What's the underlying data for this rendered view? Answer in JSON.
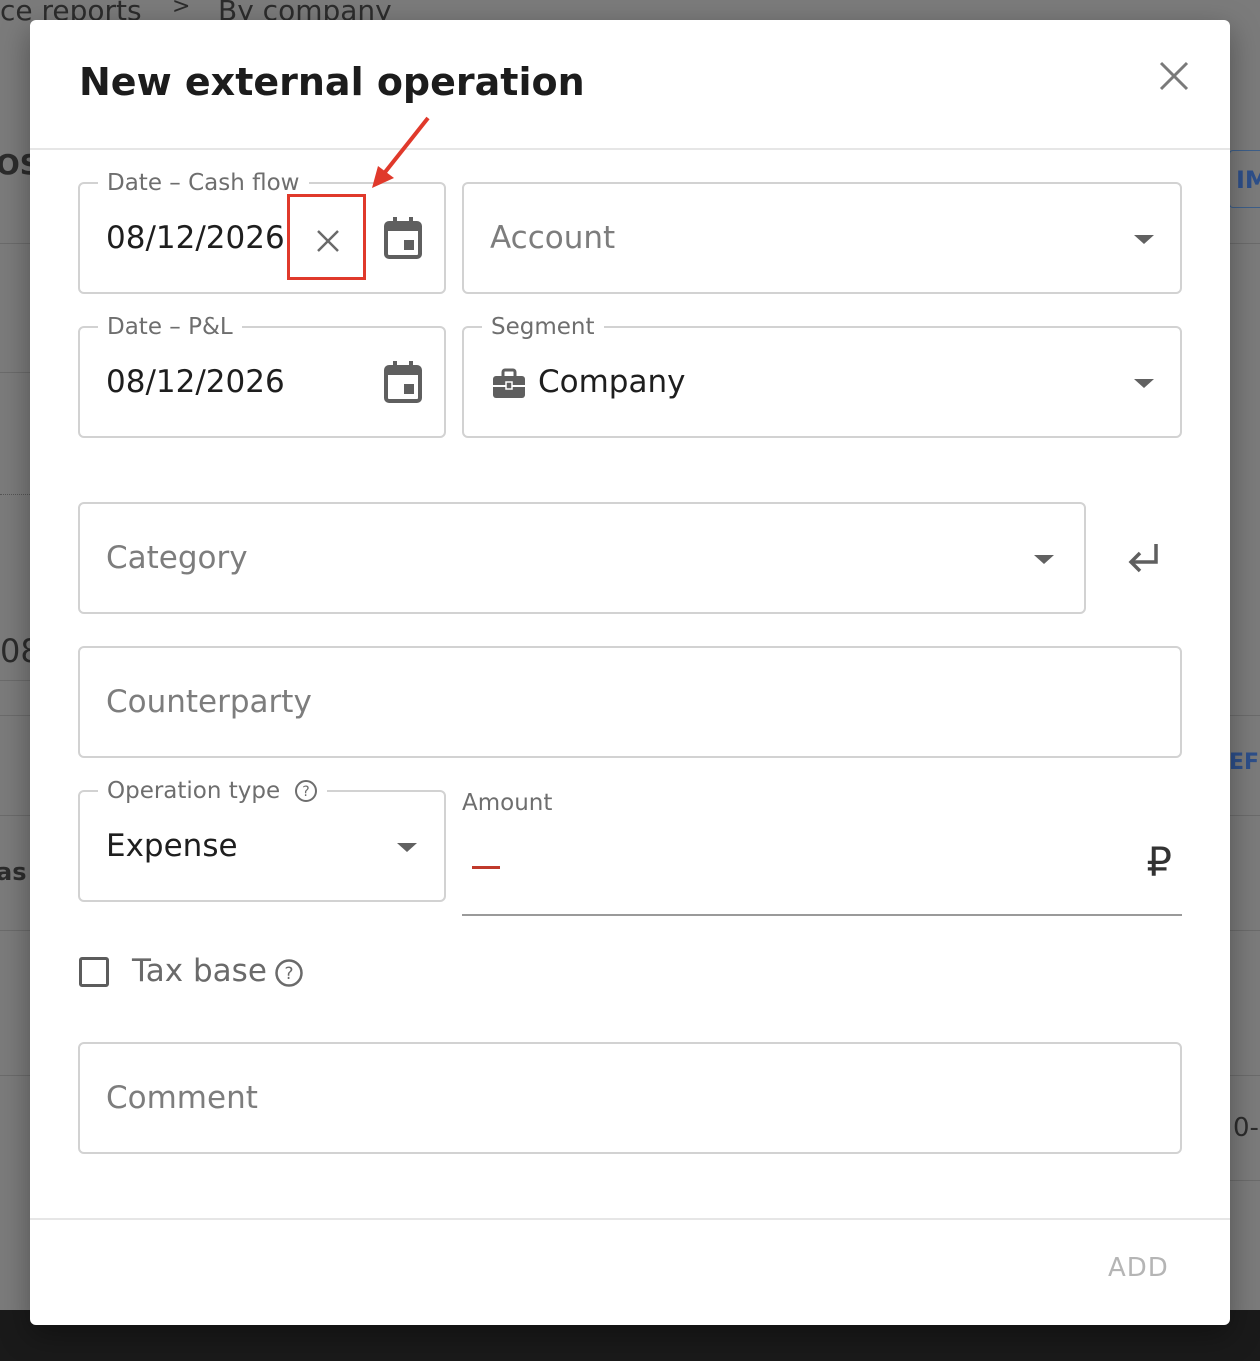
{
  "background": {
    "breadcrumb_left": "ce reports",
    "breadcrumb_sep": ">",
    "breadcrumb_right": "By company",
    "frag_os": "OS",
    "frag_08": "08",
    "frag_as": "as",
    "frag_im": "IM",
    "frag_efr": "EFR",
    "frag_0": "0-"
  },
  "modal": {
    "title": "New external operation",
    "close_icon": "close-icon",
    "fields": {
      "date_cash_flow": {
        "label": "Date – Cash flow",
        "value": "08/12/2026"
      },
      "account": {
        "placeholder": "Account"
      },
      "date_pl": {
        "label": "Date – P&L",
        "value": "08/12/2026"
      },
      "segment": {
        "label": "Segment",
        "value": "Company",
        "icon": "briefcase-icon"
      },
      "category": {
        "placeholder": "Category"
      },
      "counterparty": {
        "placeholder": "Counterparty"
      },
      "operation_type": {
        "label": "Operation type",
        "value": "Expense"
      },
      "amount": {
        "label": "Amount",
        "currency": "₽"
      },
      "tax_base": {
        "label": "Tax base",
        "checked": false
      },
      "comment": {
        "placeholder": "Comment"
      }
    },
    "add_label": "ADD"
  },
  "annotation": {
    "color": "#e0392b"
  }
}
